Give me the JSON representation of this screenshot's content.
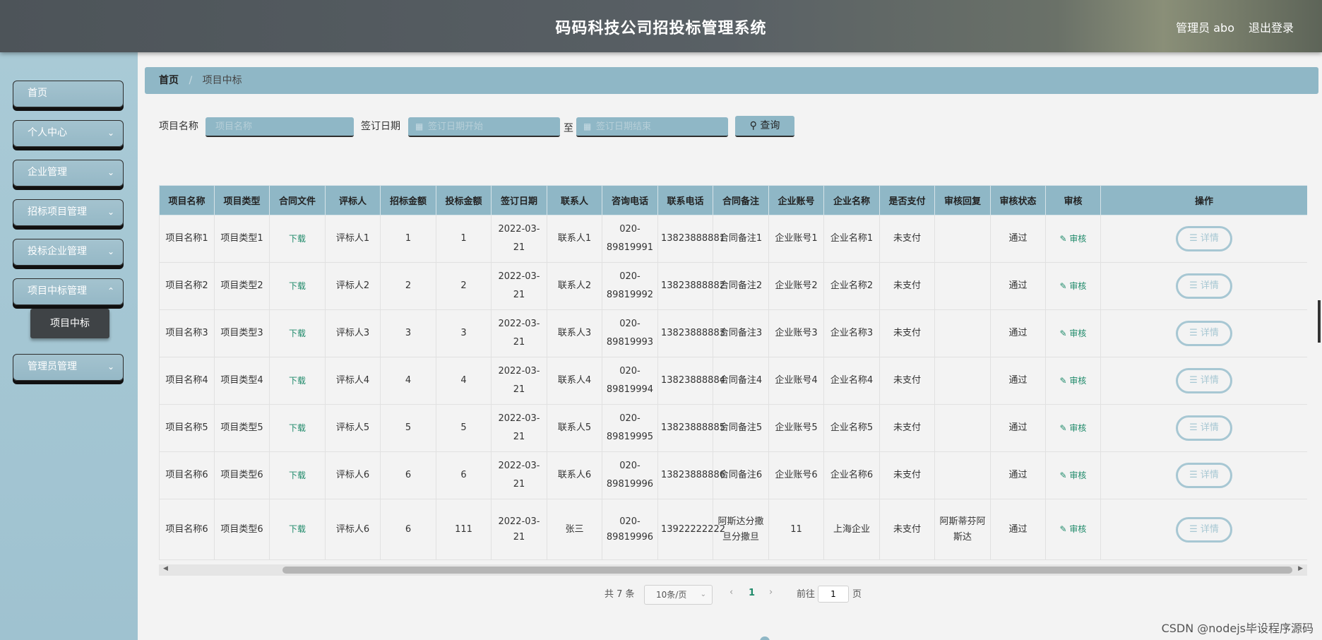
{
  "header": {
    "title": "码码科技公司招投标管理系统",
    "user": "管理员 abo",
    "logout": "退出登录"
  },
  "sidebar": {
    "items": [
      {
        "label": "首页",
        "has_chevron": false
      },
      {
        "label": "个人中心",
        "has_chevron": true
      },
      {
        "label": "企业管理",
        "has_chevron": true
      },
      {
        "label": "招标项目管理",
        "has_chevron": true
      },
      {
        "label": "投标企业管理",
        "has_chevron": true
      },
      {
        "label": "项目中标管理",
        "has_chevron": true
      },
      {
        "label": "管理员管理",
        "has_chevron": true
      }
    ],
    "active_sub": "项目中标",
    "chevron_icon": "chevron-down-icon"
  },
  "breadcrumb": {
    "home": "首页",
    "separator": "/",
    "current": "项目中标"
  },
  "search": {
    "name_label": "项目名称",
    "name_placeholder": "项目名称",
    "date_label": "签订日期",
    "date_start_placeholder": "签订日期开始",
    "to_label": "至",
    "date_end_placeholder": "签订日期结束",
    "button": "查询"
  },
  "table": {
    "columns": [
      "项目名称",
      "项目类型",
      "合同文件",
      "评标人",
      "招标金额",
      "投标金额",
      "签订日期",
      "联系人",
      "咨询电话",
      "联系电话",
      "合同备注",
      "企业账号",
      "企业名称",
      "是否支付",
      "审核回复",
      "审核状态",
      "审核",
      "操作"
    ],
    "download_label": "下载",
    "audit_label": "审核",
    "detail_label": "详情",
    "rows": [
      {
        "name": "项目名称1",
        "type": "项目类型1",
        "reviewer": "评标人1",
        "bid_amount": "1",
        "tender_amount": "1",
        "date": "2022-03-21",
        "contact": "联系人1",
        "consult_phone": "020-89819991",
        "phone": "13823888881",
        "remark": "合同备注1",
        "account": "企业账号1",
        "company": "企业名称1",
        "paid": "未支付",
        "reply": "",
        "status": "通过"
      },
      {
        "name": "项目名称2",
        "type": "项目类型2",
        "reviewer": "评标人2",
        "bid_amount": "2",
        "tender_amount": "2",
        "date": "2022-03-21",
        "contact": "联系人2",
        "consult_phone": "020-89819992",
        "phone": "13823888882",
        "remark": "合同备注2",
        "account": "企业账号2",
        "company": "企业名称2",
        "paid": "未支付",
        "reply": "",
        "status": "通过"
      },
      {
        "name": "项目名称3",
        "type": "项目类型3",
        "reviewer": "评标人3",
        "bid_amount": "3",
        "tender_amount": "3",
        "date": "2022-03-21",
        "contact": "联系人3",
        "consult_phone": "020-89819993",
        "phone": "13823888883",
        "remark": "合同备注3",
        "account": "企业账号3",
        "company": "企业名称3",
        "paid": "未支付",
        "reply": "",
        "status": "通过"
      },
      {
        "name": "项目名称4",
        "type": "项目类型4",
        "reviewer": "评标人4",
        "bid_amount": "4",
        "tender_amount": "4",
        "date": "2022-03-21",
        "contact": "联系人4",
        "consult_phone": "020-89819994",
        "phone": "13823888884",
        "remark": "合同备注4",
        "account": "企业账号4",
        "company": "企业名称4",
        "paid": "未支付",
        "reply": "",
        "status": "通过"
      },
      {
        "name": "项目名称5",
        "type": "项目类型5",
        "reviewer": "评标人5",
        "bid_amount": "5",
        "tender_amount": "5",
        "date": "2022-03-21",
        "contact": "联系人5",
        "consult_phone": "020-89819995",
        "phone": "13823888885",
        "remark": "合同备注5",
        "account": "企业账号5",
        "company": "企业名称5",
        "paid": "未支付",
        "reply": "",
        "status": "通过"
      },
      {
        "name": "项目名称6",
        "type": "项目类型6",
        "reviewer": "评标人6",
        "bid_amount": "6",
        "tender_amount": "6",
        "date": "2022-03-21",
        "contact": "联系人6",
        "consult_phone": "020-89819996",
        "phone": "13823888886",
        "remark": "合同备注6",
        "account": "企业账号6",
        "company": "企业名称6",
        "paid": "未支付",
        "reply": "",
        "status": "通过"
      },
      {
        "name": "项目名称6",
        "type": "项目类型6",
        "reviewer": "评标人6",
        "bid_amount": "6",
        "tender_amount": "111",
        "date": "2022-03-21",
        "contact": "张三",
        "consult_phone": "020-89819996",
        "phone": "13922222222",
        "remark": "阿斯达分撒旦分撒旦",
        "account": "11",
        "company": "上海企业",
        "paid": "未支付",
        "reply": "阿斯蒂芬阿斯达",
        "status": "通过"
      }
    ]
  },
  "pager": {
    "total": "共 7 条",
    "page_size": "10条/页",
    "current_page": "1",
    "goto_label": "前往",
    "goto_value": "1",
    "page_unit": "页"
  },
  "watermark": "CSDN @nodejs毕设程序源码",
  "colors": {
    "accent": "#8fb7c6",
    "link_green": "#1f8a6a",
    "header_dark": "#545b60"
  }
}
